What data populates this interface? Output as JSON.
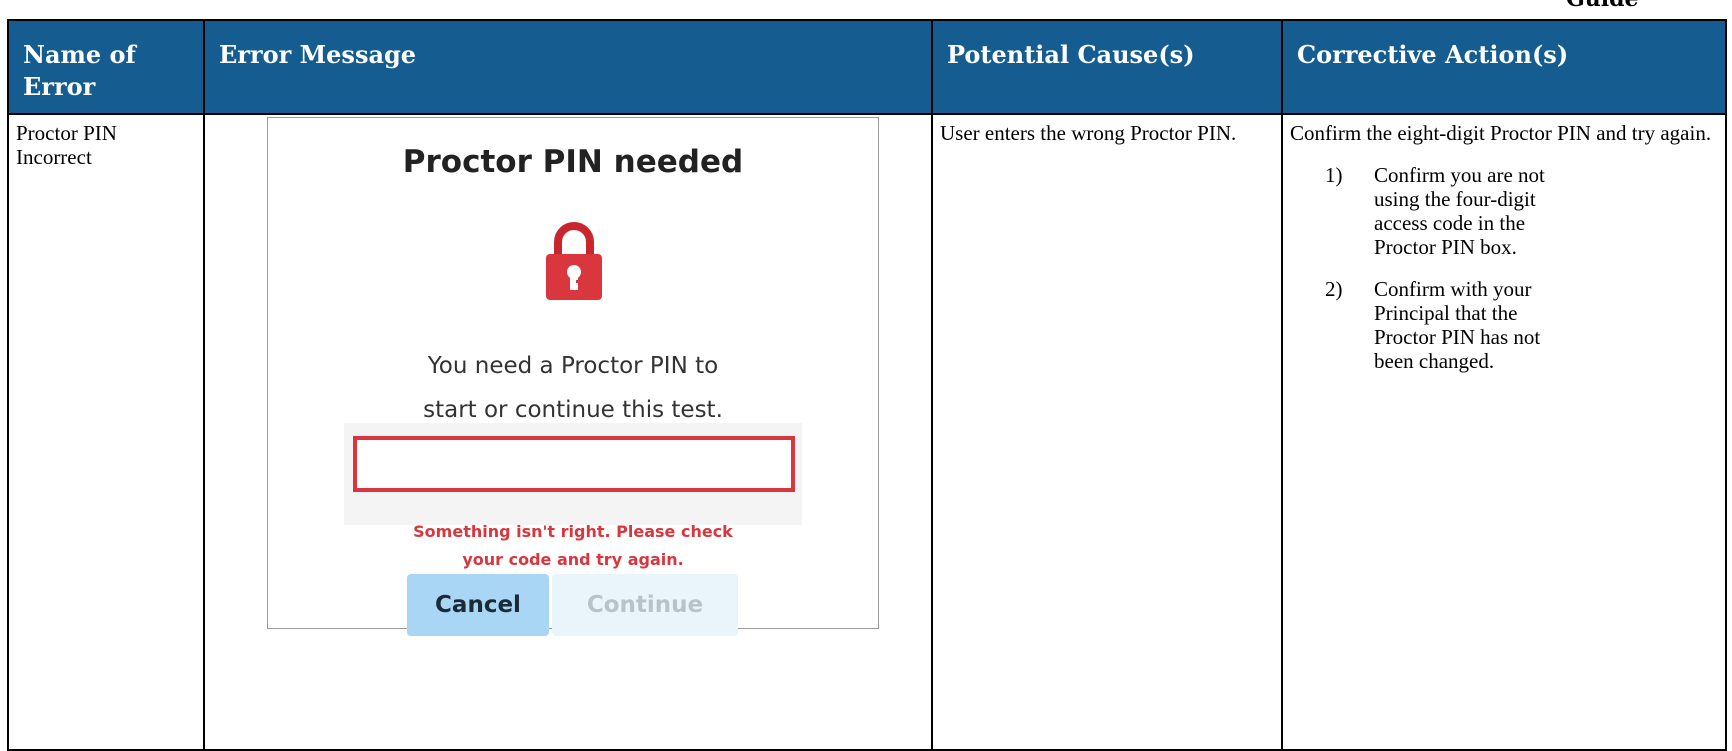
{
  "page_fragment": "Guide",
  "table": {
    "headers": [
      "Name of Error",
      "Error Message",
      "Potential Cause(s)",
      "Corrective Action(s)"
    ],
    "row": {
      "name": "Proctor PIN Incorrect",
      "cause": "User enters the wrong Proctor PIN.",
      "action_intro": "Confirm the eight-digit Proctor PIN and try again.",
      "action_steps": [
        {
          "num": "1)",
          "text": "Confirm you are not using the four-digit access code in the Proctor PIN box."
        },
        {
          "num": "2)",
          "text": "Confirm with your Principal that the Proctor PIN has not been changed."
        }
      ]
    }
  },
  "dialog": {
    "title": "Proctor PIN needed",
    "icon": "lock-icon",
    "prompt": "You need a Proctor PIN to start or continue this test.",
    "pin_value": "",
    "error": "Something isn't right. Please check your code and try again.",
    "cancel_label": "Cancel",
    "continue_label": "Continue"
  },
  "colors": {
    "header_bg": "#155d91",
    "error_red": "#d9363e",
    "cancel_bg": "#a8d6f4",
    "continue_bg": "#e9f4fb"
  }
}
